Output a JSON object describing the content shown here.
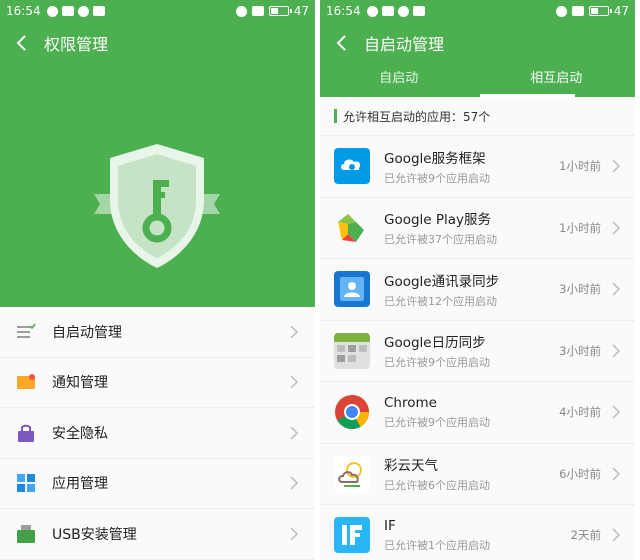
{
  "left": {
    "status": {
      "time": "16:54",
      "battery": "47"
    },
    "title": "权限管理",
    "menu": [
      {
        "label": "自启动管理",
        "icon": "startup-list-icon"
      },
      {
        "label": "通知管理",
        "icon": "notification-icon"
      },
      {
        "label": "安全隐私",
        "icon": "privacy-lock-icon"
      },
      {
        "label": "应用管理",
        "icon": "app-grid-icon"
      },
      {
        "label": "USB安装管理",
        "icon": "usb-install-icon"
      }
    ]
  },
  "right": {
    "status": {
      "time": "16:54",
      "battery": "47"
    },
    "title": "自启动管理",
    "tabs": [
      {
        "label": "自启动"
      },
      {
        "label": "相互启动"
      }
    ],
    "summary": "允许相互启动的应用：57个",
    "apps": [
      {
        "name": "Google服务框架",
        "sub": "已允许被9个应用启动",
        "time": "1小时前"
      },
      {
        "name": "Google Play服务",
        "sub": "已允许被37个应用启动",
        "time": "1小时前"
      },
      {
        "name": "Google通讯录同步",
        "sub": "已允许被12个应用启动",
        "time": "3小时前"
      },
      {
        "name": "Google日历同步",
        "sub": "已允许被9个应用启动",
        "time": "3小时前"
      },
      {
        "name": "Chrome",
        "sub": "已允许被9个应用启动",
        "time": "4小时前"
      },
      {
        "name": "彩云天气",
        "sub": "已允许被6个应用启动",
        "time": "6小时前"
      },
      {
        "name": "IF",
        "sub": "已允许被1个应用启动",
        "time": "2天前"
      }
    ]
  },
  "colors": {
    "accent": "#4caf50"
  }
}
